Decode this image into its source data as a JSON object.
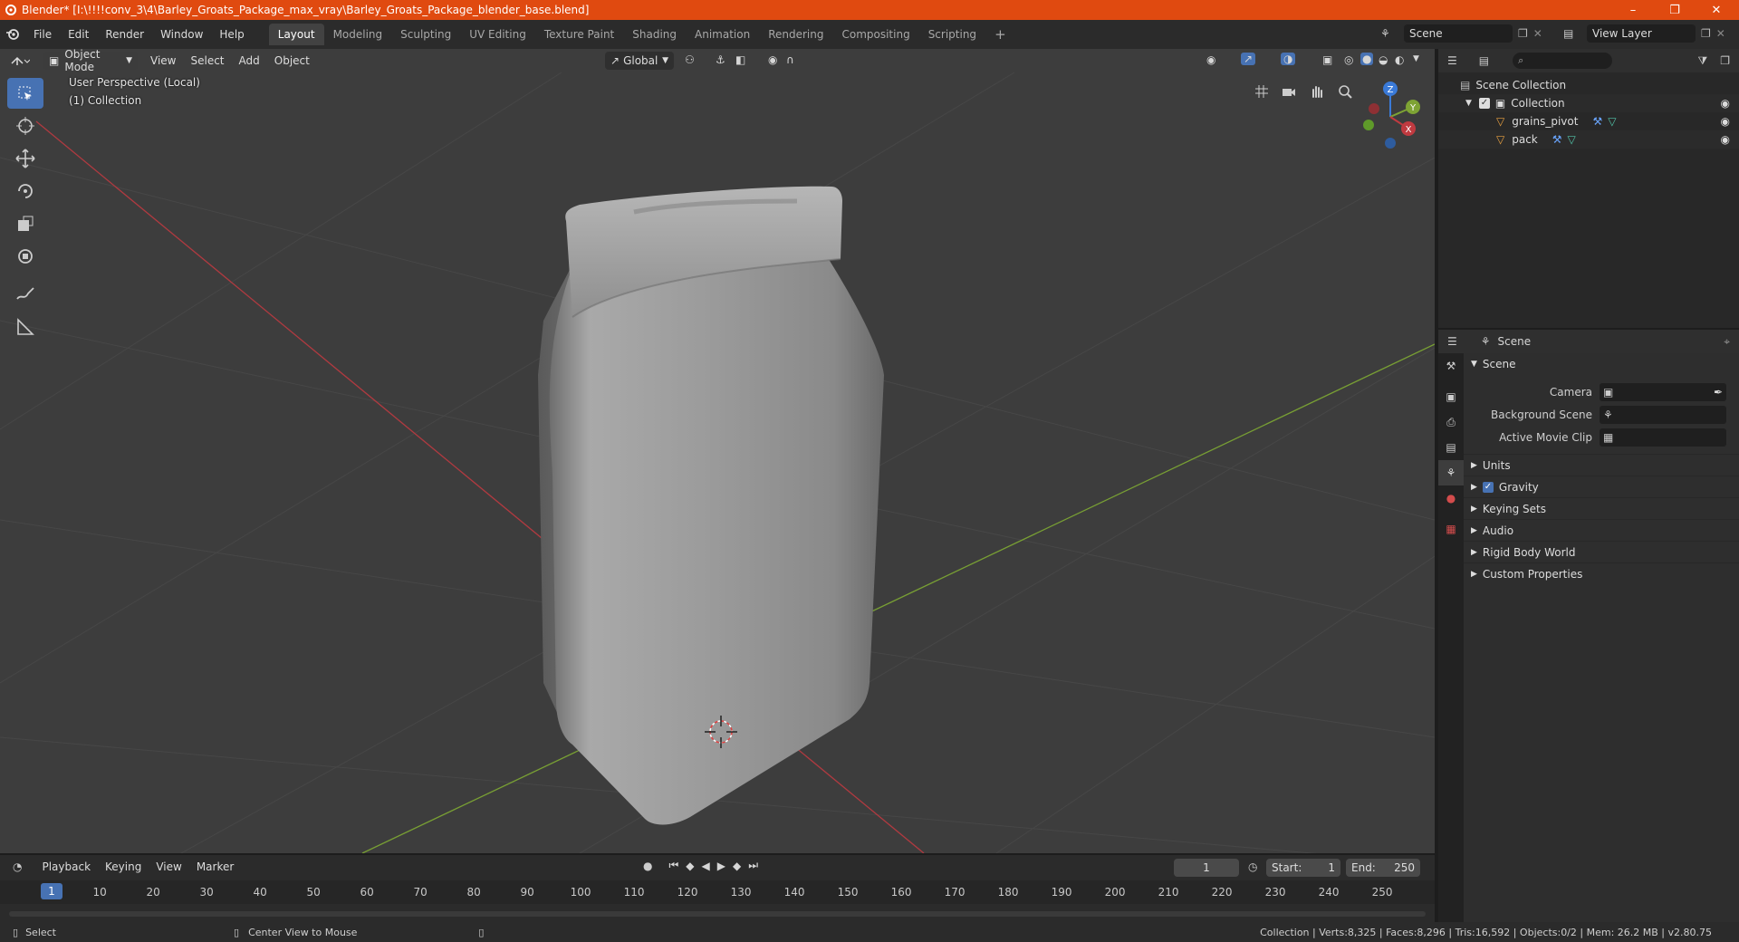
{
  "title_bar": {
    "text": "Blender* [I:\\!!!!conv_3\\4\\Barley_Groats_Package_max_vray\\Barley_Groats_Package_blender_base.blend]"
  },
  "menu": [
    "File",
    "Edit",
    "Render",
    "Window",
    "Help"
  ],
  "workspaces": [
    "Layout",
    "Modeling",
    "Sculpting",
    "UV Editing",
    "Texture Paint",
    "Shading",
    "Animation",
    "Rendering",
    "Compositing",
    "Scripting"
  ],
  "active_workspace": "Layout",
  "scene_name": "Scene",
  "view_layer": "View Layer",
  "viewport": {
    "mode": "Object Mode",
    "menus": [
      "View",
      "Select",
      "Add",
      "Object"
    ],
    "orientation": "Global",
    "overlay_line1": "User Perspective (Local)",
    "overlay_line2": "(1) Collection",
    "gizmo_labels": {
      "z": "Z",
      "y": "Y",
      "x": "X"
    }
  },
  "outliner": {
    "root": "Scene Collection",
    "collection": "Collection",
    "objects": [
      "grains_pivot",
      "pack"
    ]
  },
  "properties": {
    "context": "Scene",
    "panel": "Scene",
    "fields": [
      {
        "label": "Camera"
      },
      {
        "label": "Background Scene"
      },
      {
        "label": "Active Movie Clip"
      }
    ],
    "subpanels": [
      "Units",
      "Gravity",
      "Keying Sets",
      "Audio",
      "Rigid Body World",
      "Custom Properties"
    ],
    "gravity_checked": true
  },
  "timeline": {
    "menus": [
      "Playback",
      "Keying",
      "View",
      "Marker"
    ],
    "current_frame": "1",
    "start_label": "Start:",
    "start": "1",
    "end_label": "End:",
    "end": "250",
    "ruler": [
      "1",
      "10",
      "20",
      "30",
      "40",
      "50",
      "60",
      "70",
      "80",
      "90",
      "100",
      "110",
      "120",
      "130",
      "140",
      "150",
      "160",
      "170",
      "180",
      "190",
      "200",
      "210",
      "220",
      "230",
      "240",
      "250"
    ]
  },
  "statusbar": {
    "left": "Select",
    "middle": "Center View to Mouse",
    "right": "Collection | Verts:8,325 | Faces:8,296 | Tris:16,592 | Objects:0/2 | Mem: 26.2 MB | v2.80.75"
  },
  "colors": {
    "accent": "#4772b3",
    "titlebar": "#e04a10",
    "viewport_bg": "#3d3d3d",
    "x_axis": "#c03a40",
    "y_axis": "#7ea334",
    "z_axis": "#3a7ad8"
  }
}
